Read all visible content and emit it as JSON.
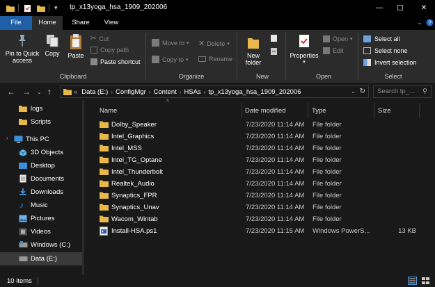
{
  "window": {
    "title": "tp_x13yoga_hsa_1909_202006",
    "minimize": "—",
    "maximize": "☐",
    "close": "✕"
  },
  "tabs": [
    "File",
    "Home",
    "Share",
    "View"
  ],
  "ribbon": {
    "clipboard": {
      "pin": "Pin to Quick\naccess",
      "copy": "Copy",
      "paste": "Paste",
      "cut": "Cut",
      "copy_path": "Copy path",
      "paste_shortcut": "Paste shortcut",
      "label": "Clipboard"
    },
    "organize": {
      "move_to": "Move to",
      "copy_to": "Copy to",
      "delete": "Delete",
      "rename": "Rename",
      "label": "Organize"
    },
    "new": {
      "new_folder": "New\nfolder",
      "label": "New"
    },
    "open": {
      "properties": "Properties",
      "open": "Open",
      "edit": "Edit",
      "label": "Open"
    },
    "select": {
      "select_all": "Select all",
      "select_none": "Select none",
      "invert_selection": "Invert selection",
      "label": "Select"
    }
  },
  "address": {
    "prefix": "«",
    "crumbs": [
      "Data (E:)",
      "ConfigMgr",
      "Content",
      "HSAs",
      "tp_x13yoga_hsa_1909_202006"
    ],
    "search_placeholder": "Search tp_..."
  },
  "nav": [
    {
      "label": "logs",
      "icon": "folder-icon"
    },
    {
      "label": "Scripts",
      "icon": "folder-icon"
    },
    {
      "label": "This PC",
      "icon": "computer-icon"
    },
    {
      "label": "3D Objects",
      "icon": "cube-icon"
    },
    {
      "label": "Desktop",
      "icon": "desktop-icon"
    },
    {
      "label": "Documents",
      "icon": "document-icon"
    },
    {
      "label": "Downloads",
      "icon": "download-icon"
    },
    {
      "label": "Music",
      "icon": "music-icon"
    },
    {
      "label": "Pictures",
      "icon": "pictures-icon"
    },
    {
      "label": "Videos",
      "icon": "video-icon"
    },
    {
      "label": "Windows (C:)",
      "icon": "drive-icon"
    },
    {
      "label": "Data (E:)",
      "icon": "drive-icon"
    }
  ],
  "columns": [
    "Name",
    "Date modified",
    "Type",
    "Size"
  ],
  "files": [
    {
      "name": "Dolby_Speaker",
      "date": "7/23/2020 11:14 AM",
      "type": "File folder",
      "size": "",
      "icon": "folder-icon"
    },
    {
      "name": "Intel_Graphics",
      "date": "7/23/2020 11:14 AM",
      "type": "File folder",
      "size": "",
      "icon": "folder-icon"
    },
    {
      "name": "Intel_MSS",
      "date": "7/23/2020 11:14 AM",
      "type": "File folder",
      "size": "",
      "icon": "folder-icon"
    },
    {
      "name": "Intel_TG_Optane",
      "date": "7/23/2020 11:14 AM",
      "type": "File folder",
      "size": "",
      "icon": "folder-icon"
    },
    {
      "name": "Intel_Thunderbolt",
      "date": "7/23/2020 11:14 AM",
      "type": "File folder",
      "size": "",
      "icon": "folder-icon"
    },
    {
      "name": "Realtek_Audio",
      "date": "7/23/2020 11:14 AM",
      "type": "File folder",
      "size": "",
      "icon": "folder-icon"
    },
    {
      "name": "Synaptics_FPR",
      "date": "7/23/2020 11:14 AM",
      "type": "File folder",
      "size": "",
      "icon": "folder-icon"
    },
    {
      "name": "Synaptics_Unav",
      "date": "7/23/2020 11:14 AM",
      "type": "File folder",
      "size": "",
      "icon": "folder-icon"
    },
    {
      "name": "Wacom_Wintab",
      "date": "7/23/2020 11:14 AM",
      "type": "File folder",
      "size": "",
      "icon": "folder-icon"
    },
    {
      "name": "Install-HSA.ps1",
      "date": "7/23/2020 11:15 AM",
      "type": "Windows PowerS...",
      "size": "13 KB",
      "icon": "powershell-file-icon"
    }
  ],
  "status": {
    "count": "10 items"
  },
  "colors": {
    "accent": "#1f5fa8",
    "folder": "#e8b84a",
    "background": "#191919",
    "ribbon": "#2b2b2b"
  }
}
